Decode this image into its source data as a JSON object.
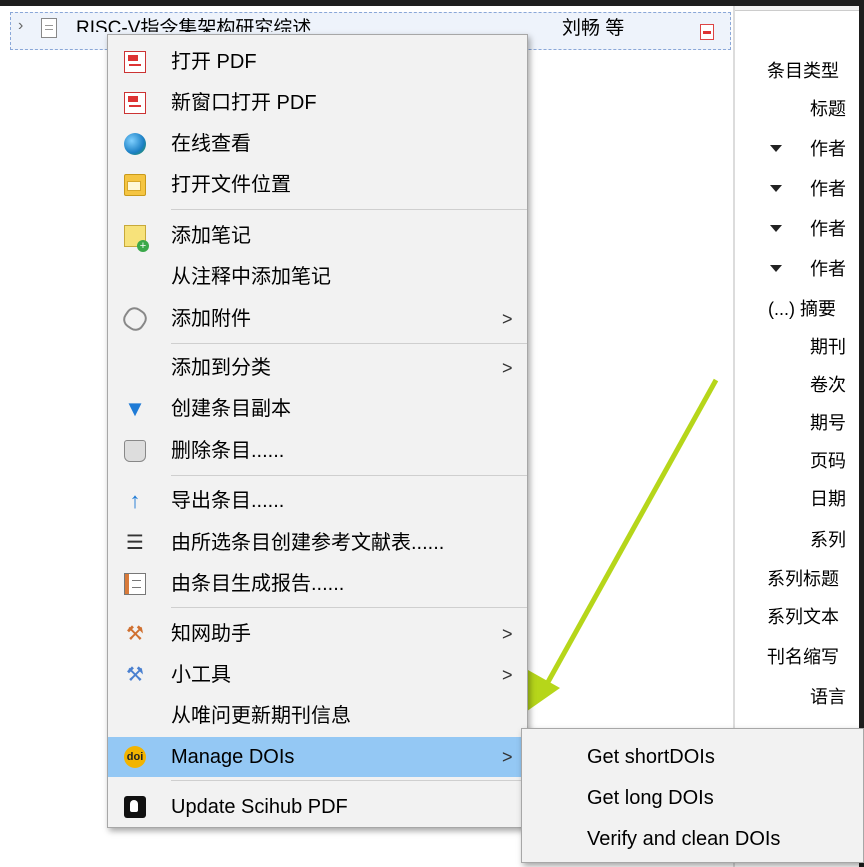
{
  "item": {
    "title": "RISC-V指令集架构研究综述",
    "creator": "刘畅 等"
  },
  "info_pane": {
    "rows": [
      "条目类型",
      "标题",
      "作者",
      "作者",
      "作者",
      "作者",
      "(...) 摘要",
      "期刊",
      "卷次",
      "期号",
      "页码",
      "日期",
      "系列",
      "系列标题",
      "系列文本",
      "刊名缩写",
      "语言"
    ]
  },
  "context_menu": {
    "items": [
      {
        "label": "打开 PDF",
        "icon": "pdf-icon"
      },
      {
        "label": "新窗口打开 PDF",
        "icon": "pdf-icon"
      },
      {
        "label": "在线查看",
        "icon": "globe-icon"
      },
      {
        "label": "打开文件位置",
        "icon": "folder-icon"
      },
      {
        "label": "添加笔记",
        "icon": "add-note-icon"
      },
      {
        "label": "从注释中添加笔记",
        "icon": ""
      },
      {
        "label": "添加附件",
        "icon": "paperclip-icon",
        "submenu": true
      },
      {
        "label": "添加到分类",
        "icon": "",
        "submenu": true
      },
      {
        "label": "创建条目副本",
        "icon": "duplicate-icon"
      },
      {
        "label": "删除条目......",
        "icon": "trash-icon"
      },
      {
        "label": "导出条目......",
        "icon": "export-icon"
      },
      {
        "label": "由所选条目创建参考文献表......",
        "icon": "bibliography-icon"
      },
      {
        "label": "由条目生成报告......",
        "icon": "report-icon"
      },
      {
        "label": "知网助手",
        "icon": "wrench-icon",
        "submenu": true
      },
      {
        "label": "小工具",
        "icon": "wrench-icon",
        "submenu": true
      },
      {
        "label": "从唯问更新期刊信息",
        "icon": ""
      },
      {
        "label": "Manage DOIs",
        "icon": "doi-icon",
        "submenu": true,
        "highlighted": true
      },
      {
        "label": "Update Scihub PDF",
        "icon": "scihub-icon"
      }
    ],
    "submenu_arrow": ">"
  },
  "doi_submenu": {
    "items": [
      "Get shortDOIs",
      "Get long DOIs",
      "Verify and clean DOIs"
    ]
  },
  "colors": {
    "highlight": "#94c8f4",
    "menu_bg": "#f2f2f2",
    "annotation_arrow": "#b6d61a",
    "dark_frame": "#1e1e1e"
  }
}
